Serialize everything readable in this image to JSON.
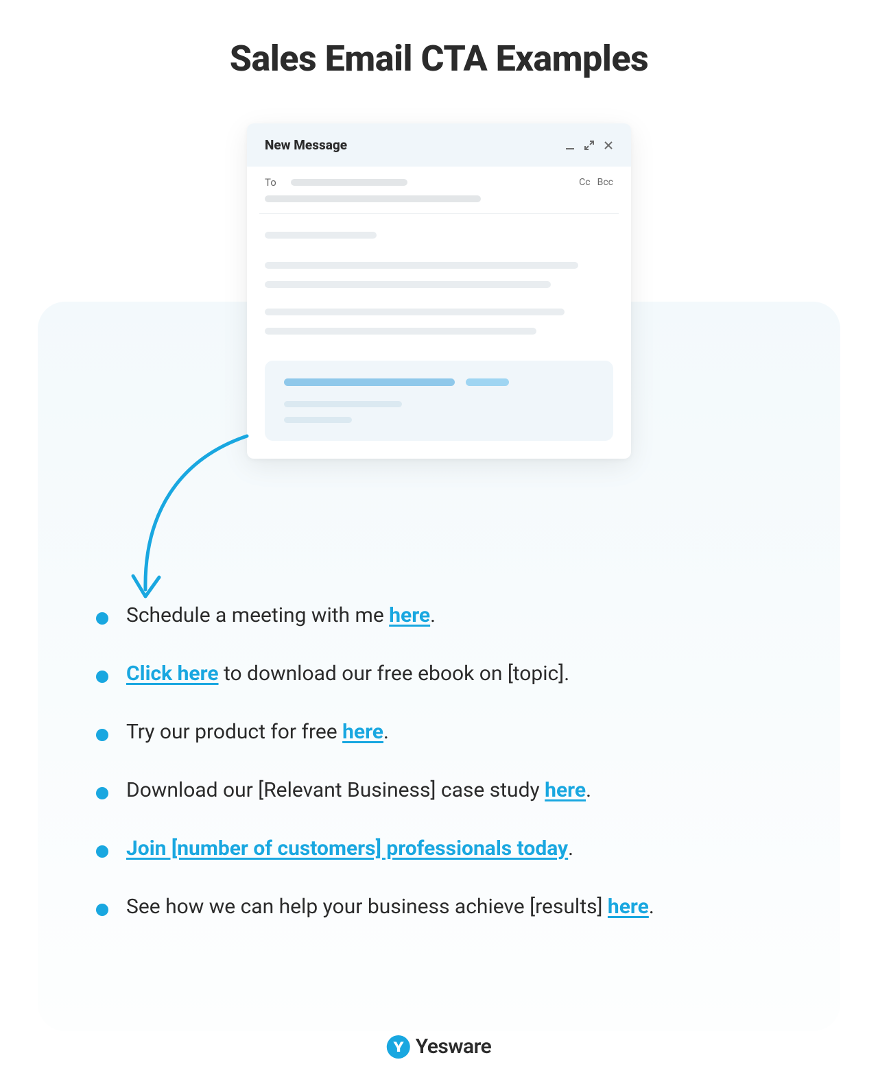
{
  "title": "Sales Email CTA Examples",
  "compose": {
    "header": "New Message",
    "to_label": "To",
    "cc_label": "Cc",
    "bcc_label": "Bcc"
  },
  "examples": [
    {
      "pre": "Schedule a meeting with me ",
      "link": "here",
      "post": "."
    },
    {
      "pre": "",
      "link": "Click here",
      "post": " to download our free ebook on [topic]."
    },
    {
      "pre": "Try our product for free ",
      "link": "here",
      "post": "."
    },
    {
      "pre": "Download our [Relevant Business] case study ",
      "link": "here",
      "post": "."
    },
    {
      "pre": "",
      "link": "Join [number of customers] professionals today",
      "post": "."
    },
    {
      "pre": "See how we can help your business achieve [results] ",
      "link": "here",
      "post": "."
    }
  ],
  "brand": "Yesware"
}
